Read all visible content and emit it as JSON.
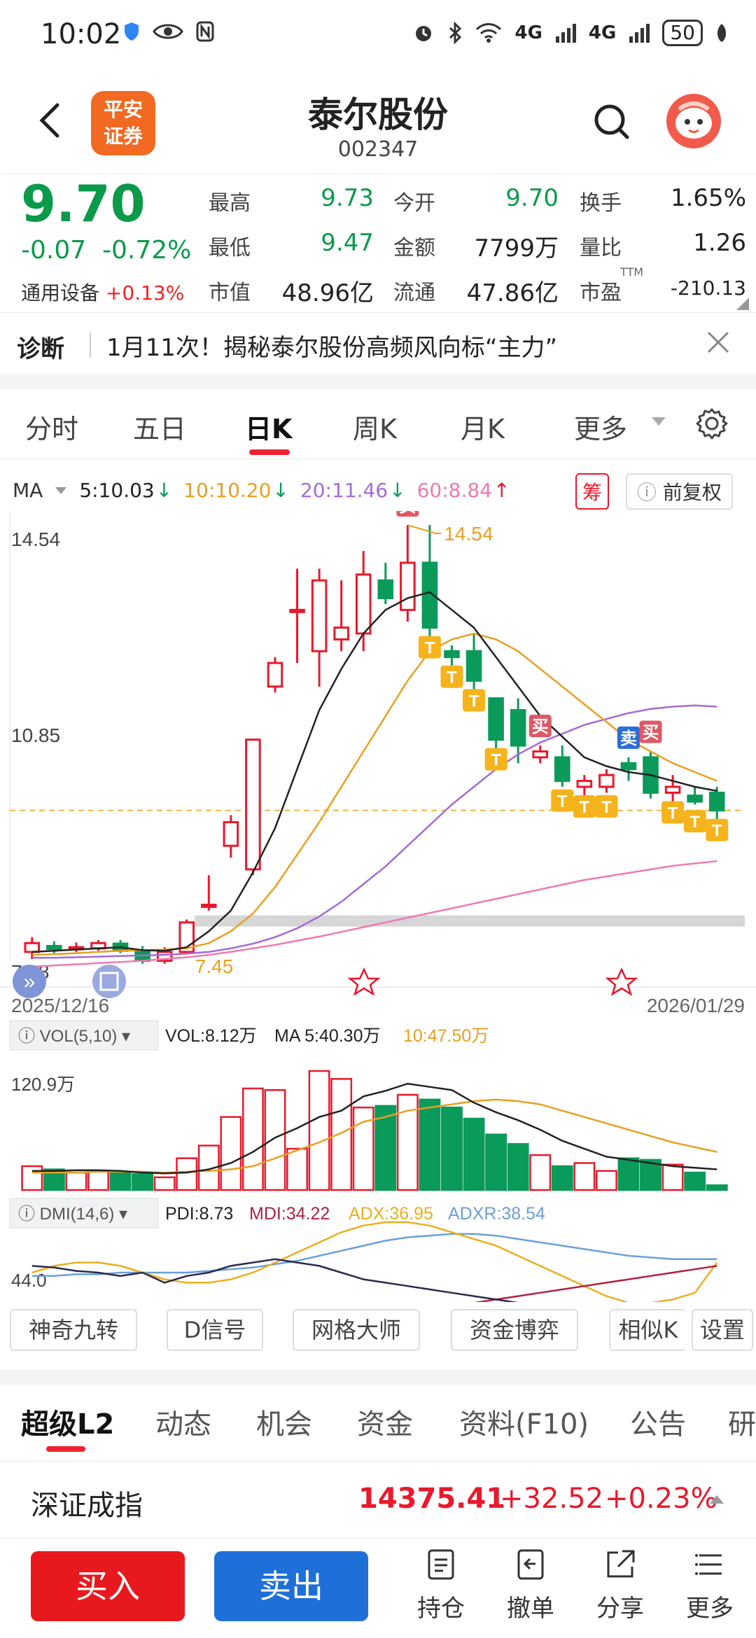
{
  "status_bar": {
    "time": "10:02",
    "battery": "50",
    "net1": "4G",
    "net2": "4G"
  },
  "header": {
    "logo_line1": "平安",
    "logo_line2": "证券",
    "name": "泰尔股份",
    "code": "002347"
  },
  "quote": {
    "price": "9.70",
    "change": "-0.07",
    "change_pct": "-0.72%",
    "sector_name": "通用设备",
    "sector_pct": "+0.13%",
    "rows": [
      {
        "l1": "最高",
        "v1": "9.73",
        "l2": "今开",
        "v2": "9.70",
        "l3": "换手",
        "v3": "1.65%"
      },
      {
        "l1": "最低",
        "v1": "9.47",
        "l2": "金额",
        "v2": "7799万",
        "l3": "量比",
        "v3": "1.26"
      },
      {
        "l1": "市值",
        "v1": "48.96亿",
        "l2": "流通",
        "v2": "47.86亿",
        "l3": "市盈",
        "v3": "-210.13",
        "l3_sup": "TTM"
      }
    ]
  },
  "diagnosis": {
    "label": "诊断",
    "text": "1月11次！揭秘泰尔股份高频风向标“主力”"
  },
  "tabs": [
    "分时",
    "五日",
    "日K",
    "周K",
    "月K",
    "更多"
  ],
  "chart_header": {
    "ma": "MA",
    "ma5": "5:10.03",
    "ma10": "10:10.20",
    "ma20": "20:11.46",
    "ma60": "60:8.84",
    "chip_label": "筹",
    "restore_label": "前复权"
  },
  "chart_data": {
    "type": "candlestick",
    "price_max_label": "14.54",
    "price_mid_label": "10.85",
    "price_min_label": "7.18",
    "low_marker": "7.45",
    "high_marker": "14.54",
    "ylim": [
      7.18,
      14.54
    ],
    "date_start": "2025/12/16",
    "date_end": "2026/01/29",
    "candles": [
      {
        "o": 7.3,
        "c": 7.45,
        "h": 7.55,
        "l": 7.18
      },
      {
        "o": 7.4,
        "c": 7.35,
        "h": 7.48,
        "l": 7.28
      },
      {
        "o": 7.35,
        "c": 7.38,
        "h": 7.46,
        "l": 7.3
      },
      {
        "o": 7.36,
        "c": 7.45,
        "h": 7.5,
        "l": 7.32
      },
      {
        "o": 7.44,
        "c": 7.32,
        "h": 7.5,
        "l": 7.28
      },
      {
        "o": 7.32,
        "c": 7.15,
        "h": 7.4,
        "l": 7.1
      },
      {
        "o": 7.15,
        "c": 7.3,
        "h": 7.38,
        "l": 7.1
      },
      {
        "o": 7.3,
        "c": 7.8,
        "h": 7.85,
        "l": 7.28
      },
      {
        "o": 8.1,
        "c": 8.1,
        "h": 8.6,
        "l": 8.0
      },
      {
        "o": 9.1,
        "c": 9.5,
        "h": 9.62,
        "l": 8.9
      },
      {
        "o": 8.7,
        "c": 10.9,
        "h": 10.9,
        "l": 8.6
      },
      {
        "o": 11.8,
        "c": 12.2,
        "h": 12.3,
        "l": 11.7
      },
      {
        "o": 13.1,
        "c": 13.1,
        "h": 13.8,
        "l": 12.2
      },
      {
        "o": 12.4,
        "c": 13.6,
        "h": 13.8,
        "l": 11.8
      },
      {
        "o": 12.6,
        "c": 12.8,
        "h": 13.6,
        "l": 12.4
      },
      {
        "o": 12.7,
        "c": 13.7,
        "h": 14.1,
        "l": 12.4
      },
      {
        "o": 13.6,
        "c": 13.3,
        "h": 13.9,
        "l": 13.2
      },
      {
        "o": 13.1,
        "c": 13.9,
        "h": 14.54,
        "l": 12.9
      },
      {
        "o": 13.9,
        "c": 12.8,
        "h": 14.54,
        "l": 12.6
      },
      {
        "o": 12.4,
        "c": 12.3,
        "h": 12.5,
        "l": 12.1
      },
      {
        "o": 12.4,
        "c": 11.9,
        "h": 12.7,
        "l": 11.6
      },
      {
        "o": 11.6,
        "c": 10.9,
        "h": 11.6,
        "l": 10.7
      },
      {
        "o": 11.4,
        "c": 10.8,
        "h": 11.6,
        "l": 10.5
      },
      {
        "o": 10.6,
        "c": 10.7,
        "h": 10.8,
        "l": 10.5
      },
      {
        "o": 10.6,
        "c": 10.2,
        "h": 10.8,
        "l": 10.1
      },
      {
        "o": 10.1,
        "c": 10.2,
        "h": 10.3,
        "l": 9.95
      },
      {
        "o": 10.1,
        "c": 10.3,
        "h": 10.4,
        "l": 10.0
      },
      {
        "o": 10.5,
        "c": 10.4,
        "h": 10.6,
        "l": 10.2
      },
      {
        "o": 10.6,
        "c": 10.0,
        "h": 10.7,
        "l": 9.9
      },
      {
        "o": 10.0,
        "c": 10.1,
        "h": 10.3,
        "l": 9.7
      },
      {
        "o": 9.95,
        "c": 9.85,
        "h": 10.1,
        "l": 9.8
      },
      {
        "o": 10.0,
        "c": 9.7,
        "h": 10.1,
        "l": 9.47
      }
    ],
    "ma5": [
      7.3,
      7.32,
      7.34,
      7.36,
      7.38,
      7.33,
      7.32,
      7.38,
      7.65,
      8.0,
      8.65,
      9.4,
      10.4,
      11.4,
      12.1,
      12.7,
      13.1,
      13.3,
      13.4,
      13.1,
      12.8,
      12.3,
      11.8,
      11.3,
      10.95,
      10.6,
      10.45,
      10.35,
      10.3,
      10.2,
      10.1,
      10.03
    ],
    "ma10": [
      7.25,
      7.26,
      7.28,
      7.3,
      7.32,
      7.33,
      7.34,
      7.36,
      7.45,
      7.65,
      7.95,
      8.4,
      8.95,
      9.5,
      10.1,
      10.7,
      11.3,
      11.9,
      12.4,
      12.6,
      12.7,
      12.6,
      12.4,
      12.1,
      11.8,
      11.5,
      11.2,
      10.9,
      10.7,
      10.5,
      10.35,
      10.2
    ],
    "ma20": [
      7.2,
      7.2,
      7.21,
      7.22,
      7.23,
      7.24,
      7.25,
      7.27,
      7.3,
      7.36,
      7.44,
      7.55,
      7.7,
      7.9,
      8.15,
      8.45,
      8.75,
      9.1,
      9.45,
      9.8,
      10.1,
      10.4,
      10.65,
      10.85,
      11.0,
      11.15,
      11.25,
      11.35,
      11.42,
      11.46,
      11.48,
      11.46
    ],
    "ma60": [
      7.05,
      7.07,
      7.09,
      7.11,
      7.13,
      7.15,
      7.18,
      7.21,
      7.25,
      7.3,
      7.36,
      7.42,
      7.49,
      7.56,
      7.64,
      7.72,
      7.8,
      7.88,
      7.96,
      8.04,
      8.12,
      8.2,
      8.28,
      8.36,
      8.44,
      8.52,
      8.58,
      8.64,
      8.7,
      8.76,
      8.8,
      8.84
    ],
    "signals": [
      {
        "i": 17,
        "t": "买"
      },
      {
        "i": 18,
        "t": "T"
      },
      {
        "i": 19,
        "t": "T"
      },
      {
        "i": 20,
        "t": "T"
      },
      {
        "i": 21,
        "t": "T"
      },
      {
        "i": 23,
        "t": "买"
      },
      {
        "i": 24,
        "t": "T"
      },
      {
        "i": 25,
        "t": "T"
      },
      {
        "i": 26,
        "t": "T"
      },
      {
        "i": 27,
        "t": "卖"
      },
      {
        "i": 28,
        "t": "买"
      },
      {
        "i": 29,
        "t": "T"
      },
      {
        "i": 30,
        "t": "T"
      },
      {
        "i": 31,
        "t": "T"
      }
    ],
    "vol_header": {
      "label": "VOL(5,10)",
      "vol": "VOL:8.12万",
      "ma5": "MA 5:40.30万",
      "ma10": "10:47.50万"
    },
    "vol_axis_label": "120.9万",
    "volumes": [
      30,
      26,
      22,
      24,
      22,
      20,
      16,
      40,
      56,
      92,
      128,
      126,
      52,
      150,
      140,
      104,
      106,
      120,
      114,
      104,
      90,
      70,
      58,
      44,
      30,
      34,
      24,
      40,
      38,
      32,
      22,
      6
    ],
    "vol_max": 150,
    "dmi_header": {
      "label": "DMI(14,6)",
      "pdi": "PDI:8.73",
      "mdi": "MDI:34.22",
      "adx": "ADX:36.95",
      "adxr": "ADXR:38.54"
    },
    "dmi_axis_label": "44.0"
  },
  "tool_buttons": [
    "神奇九转",
    "D信号",
    "网格大师",
    "资金博弈",
    "相似K",
    "设置"
  ],
  "bottom_tabs": [
    "超级L2",
    "动态",
    "机会",
    "资金",
    "资料(F10)",
    "公告",
    "研"
  ],
  "index": {
    "name": "深证成指",
    "value": "14375.41",
    "change": "+32.52",
    "pct": "+0.23%"
  },
  "actions": {
    "buy": "买入",
    "sell": "卖出",
    "hold": "持仓",
    "cancel": "撤单",
    "share": "分享",
    "more": "更多"
  },
  "colors": {
    "up": "#e8192c",
    "down": "#0a9a5a",
    "ma5": "#222222",
    "ma10": "#e8a020",
    "ma20": "#a56bd6",
    "ma60": "#ee7ab0"
  }
}
